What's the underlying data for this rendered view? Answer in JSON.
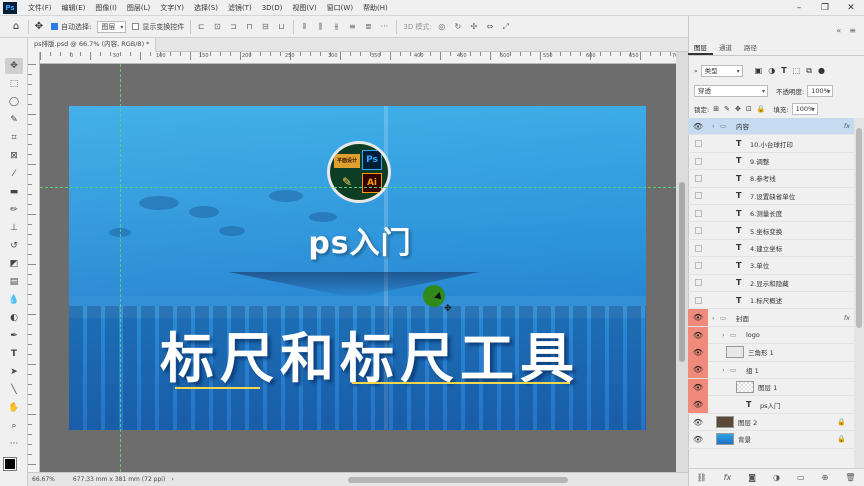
{
  "menu": {
    "app_icon": "Ps",
    "items": [
      "文件(F)",
      "编辑(E)",
      "图像(I)",
      "图层(L)",
      "文字(Y)",
      "选择(S)",
      "滤镜(T)",
      "3D(D)",
      "视图(V)",
      "窗口(W)",
      "帮助(H)"
    ]
  },
  "options": {
    "auto_select_label": "自动选择:",
    "auto_select_value": "图层",
    "show_transform_label": "显示变换控件",
    "mode_3d_label": "3D 模式:"
  },
  "document_tab": {
    "title": "ps排版.psd @ 66.7% (内容, RGB/8) *"
  },
  "canvas": {
    "subtitle": "ps入门",
    "main_title": "标尺和标尺工具",
    "logo_top_text": "平面设计",
    "logo_ps": "Ps",
    "logo_ai": "Ai",
    "accent_color": "#f2d64b",
    "guide_color": "#55d07a"
  },
  "status": {
    "zoom": "66.67%",
    "doc_size": "677.33 mm x 381 mm (72 ppi)"
  },
  "ruler_top_labels": [
    "0",
    "50",
    "100",
    "150",
    "200",
    "250",
    "300",
    "350",
    "400",
    "450",
    "500",
    "550",
    "600",
    "650",
    "700"
  ],
  "panels": {
    "tabs": [
      "图层",
      "通道",
      "路径"
    ],
    "filter_label": "类型",
    "blend_mode": "穿透",
    "opacity_label": "不透明度:",
    "opacity_value": "100%",
    "lock_label": "锁定:",
    "fill_label": "填充:",
    "fill_value": "100%"
  },
  "layers": [
    {
      "name": "内容",
      "kind": "group",
      "selected": true,
      "fx": "fx",
      "eye": "visible"
    },
    {
      "name": "10.小台球打印",
      "kind": "text",
      "eye": "hidden"
    },
    {
      "name": "9.调整",
      "kind": "text",
      "eye": "hidden"
    },
    {
      "name": "8.参考线",
      "kind": "text",
      "eye": "hidden"
    },
    {
      "name": "7.设置缺省单位",
      "kind": "text",
      "eye": "hidden"
    },
    {
      "name": "6.测量长度",
      "kind": "text",
      "eye": "hidden"
    },
    {
      "name": "5.坐标变换",
      "kind": "text",
      "eye": "hidden"
    },
    {
      "name": "4.建立坐标",
      "kind": "text",
      "eye": "hidden"
    },
    {
      "name": "3.单位",
      "kind": "text",
      "eye": "hidden"
    },
    {
      "name": "2.显示和隐藏",
      "kind": "text",
      "eye": "hidden"
    },
    {
      "name": "1.标尺概述",
      "kind": "text",
      "eye": "hidden"
    },
    {
      "name": "封面",
      "kind": "group",
      "fx": "fx",
      "eye": "red"
    },
    {
      "name": "logo",
      "kind": "group",
      "eye": "red"
    },
    {
      "name": "三角形 1",
      "kind": "shape",
      "eye": "red"
    },
    {
      "name": "组 1",
      "kind": "group",
      "eye": "red"
    },
    {
      "name": "图层 1",
      "kind": "pixel",
      "eye": "red"
    },
    {
      "name": "ps入门",
      "kind": "text",
      "eye": "red"
    },
    {
      "name": "图层 2",
      "kind": "pixel",
      "lock": true,
      "eye": "visible"
    },
    {
      "name": "背景",
      "kind": "bg",
      "lock": true,
      "eye": "visible"
    }
  ],
  "icons": {
    "move": "move-icon",
    "home": "home-icon",
    "eye": "eye-icon",
    "lock": "lock-icon",
    "text": "text-layer-icon",
    "folder": "folder-icon"
  }
}
